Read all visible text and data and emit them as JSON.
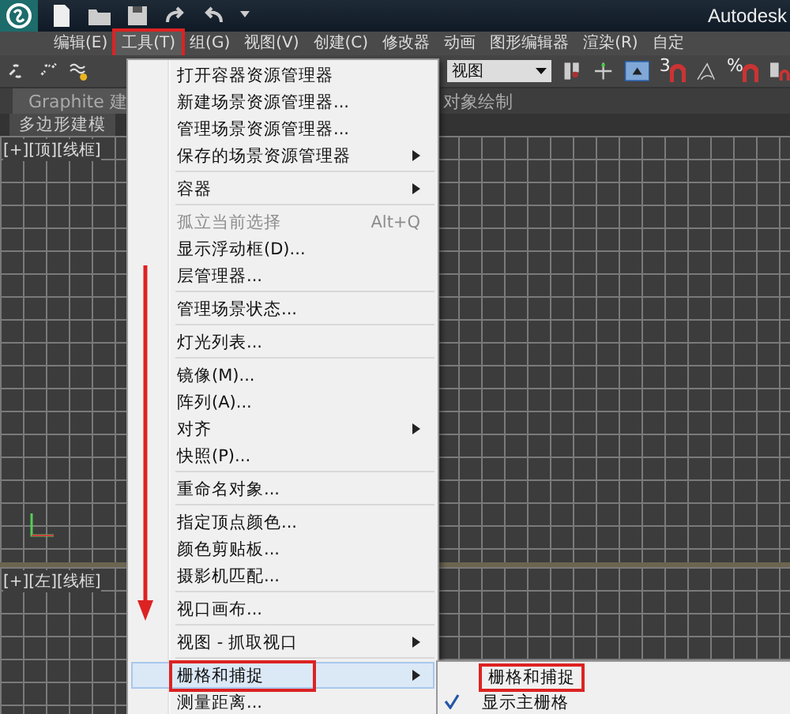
{
  "title_bar": {
    "title": "Autodesk"
  },
  "menu_bar": [
    {
      "label": "编辑(E)",
      "selected": false
    },
    {
      "label": "工具(T)",
      "selected": true
    },
    {
      "label": "组(G)",
      "selected": false
    },
    {
      "label": "视图(V)",
      "selected": false
    },
    {
      "label": "创建(C)",
      "selected": false
    },
    {
      "label": "修改器",
      "selected": false
    },
    {
      "label": "动画",
      "selected": false
    },
    {
      "label": "图形编辑器",
      "selected": false
    },
    {
      "label": "渲染(R)",
      "selected": false
    },
    {
      "label": "自定",
      "selected": false
    }
  ],
  "toolbar": {
    "view_dropdown": "视图",
    "angle_snap_label": "3",
    "percent_snap_label": "%"
  },
  "ribbon": {
    "tabs": [
      "Graphite 建",
      "对象绘制"
    ],
    "panel": "多边形建模"
  },
  "viewports": [
    {
      "label": "[+][顶][线框]"
    },
    {
      "label": "[+][左][线框]"
    }
  ],
  "menu": [
    {
      "kind": "item",
      "label": "打开容器资源管理器",
      "submenu": false,
      "disabled": false,
      "selected": false
    },
    {
      "kind": "item",
      "label": "新建场景资源管理器...",
      "submenu": false,
      "disabled": false,
      "selected": false
    },
    {
      "kind": "item",
      "label": "管理场景资源管理器...",
      "submenu": false,
      "disabled": false,
      "selected": false
    },
    {
      "kind": "item",
      "label": "保存的场景资源管理器",
      "submenu": true,
      "disabled": false,
      "selected": false
    },
    {
      "kind": "separator"
    },
    {
      "kind": "item",
      "label": "容器",
      "submenu": true,
      "disabled": false,
      "selected": false
    },
    {
      "kind": "separator"
    },
    {
      "kind": "item",
      "label": "孤立当前选择",
      "shortcut": "Alt+Q",
      "submenu": false,
      "disabled": true,
      "selected": false
    },
    {
      "kind": "item",
      "label": "显示浮动框(D)...",
      "submenu": false,
      "disabled": false,
      "selected": false
    },
    {
      "kind": "item",
      "label": "层管理器...",
      "submenu": false,
      "disabled": false,
      "selected": false
    },
    {
      "kind": "separator"
    },
    {
      "kind": "item",
      "label": "管理场景状态...",
      "submenu": false,
      "disabled": false,
      "selected": false
    },
    {
      "kind": "separator"
    },
    {
      "kind": "item",
      "label": "灯光列表...",
      "submenu": false,
      "disabled": false,
      "selected": false
    },
    {
      "kind": "separator"
    },
    {
      "kind": "item",
      "label": "镜像(M)...",
      "submenu": false,
      "disabled": false,
      "selected": false
    },
    {
      "kind": "item",
      "label": "阵列(A)...",
      "submenu": false,
      "disabled": false,
      "selected": false
    },
    {
      "kind": "item",
      "label": "对齐",
      "submenu": true,
      "disabled": false,
      "selected": false
    },
    {
      "kind": "item",
      "label": "快照(P)...",
      "submenu": false,
      "disabled": false,
      "selected": false
    },
    {
      "kind": "separator"
    },
    {
      "kind": "item",
      "label": "重命名对象...",
      "submenu": false,
      "disabled": false,
      "selected": false
    },
    {
      "kind": "separator"
    },
    {
      "kind": "item",
      "label": "指定顶点颜色...",
      "submenu": false,
      "disabled": false,
      "selected": false
    },
    {
      "kind": "item",
      "label": "颜色剪贴板...",
      "submenu": false,
      "disabled": false,
      "selected": false
    },
    {
      "kind": "item",
      "label": "摄影机匹配...",
      "submenu": false,
      "disabled": false,
      "selected": false
    },
    {
      "kind": "separator"
    },
    {
      "kind": "item",
      "label": "视口画布...",
      "submenu": false,
      "disabled": false,
      "selected": false
    },
    {
      "kind": "separator"
    },
    {
      "kind": "item",
      "label": "视图 - 抓取视口",
      "submenu": true,
      "disabled": false,
      "selected": false
    },
    {
      "kind": "separator"
    },
    {
      "kind": "item",
      "label": "栅格和捕捉",
      "submenu": true,
      "disabled": false,
      "selected": true
    },
    {
      "kind": "item",
      "label": "测量距离...",
      "submenu": false,
      "disabled": false,
      "selected": false
    }
  ],
  "submenu": [
    {
      "label": "栅格和捕捉",
      "checked": false,
      "selected": true
    },
    {
      "label": "显示主栅格",
      "checked": true,
      "selected": false
    }
  ]
}
